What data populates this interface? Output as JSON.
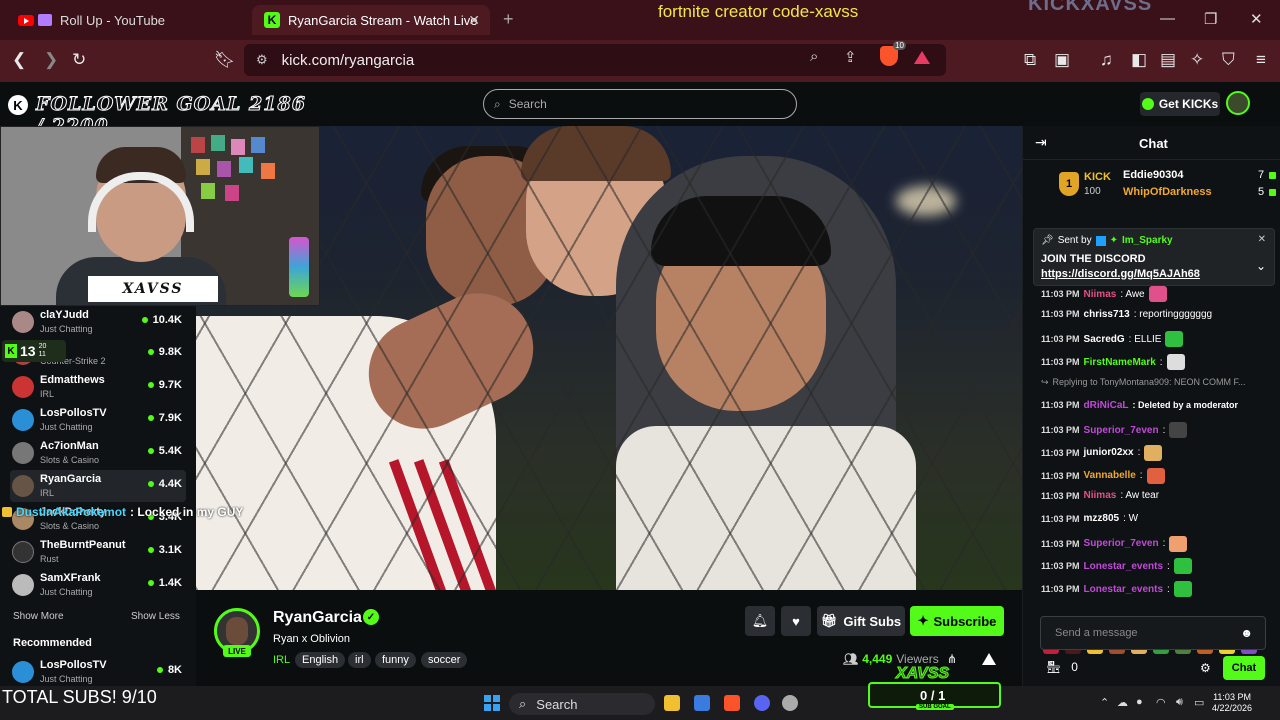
{
  "browser": {
    "tabs": [
      {
        "title": "Roll Up - YouTube",
        "active": false
      },
      {
        "title": "RyanGarcia Stream - Watch Live",
        "active": true
      }
    ],
    "url": "kick.com/ryangarcia",
    "brave_shield_count": "10"
  },
  "overlay": {
    "top_text": "fortnite creator code-xavss",
    "brand_text": "KICKXAVSS",
    "follower_goal": "FOLLOWER GOAL 2186 / 2200",
    "webcam_label": "XAVSS",
    "kick_badge_count": "13",
    "kick_badge_small1": "20",
    "kick_badge_small2": "11",
    "chat_overlay_user": "DustinAkaPokemot",
    "chat_overlay_text": ": Locked in my GUY",
    "total_subs": "TOTAL SUBS! 9/10",
    "sub_goal_value": "0 / 1",
    "sub_goal_label": "SUB GOAL",
    "sub_goal_logo": "XAVSS"
  },
  "kick": {
    "search_placeholder": "Search",
    "get_kicks": "Get KICKs",
    "sidebar": {
      "channels": [
        {
          "name": "claYJudd",
          "category": "Just Chatting",
          "viewers": "10.4K"
        },
        {
          "name": "",
          "category": "Counter-Strike 2",
          "viewers": "9.8K"
        },
        {
          "name": "Edmatthews",
          "category": "IRL",
          "viewers": "9.7K"
        },
        {
          "name": "LosPollosTV",
          "category": "Just Chatting",
          "viewers": "7.9K"
        },
        {
          "name": "Ac7ionMan",
          "category": "Slots & Casino",
          "viewers": "5.4K"
        },
        {
          "name": "RyanGarcia",
          "category": "IRL",
          "viewers": "4.4K"
        },
        {
          "name": "JackDoherty",
          "category": "Slots & Casino",
          "viewers": "3.4K"
        },
        {
          "name": "TheBurntPeanut",
          "category": "Rust",
          "viewers": "3.1K"
        },
        {
          "name": "SamXFrank",
          "category": "Just Chatting",
          "viewers": "1.4K"
        }
      ],
      "show_more": "Show More",
      "show_less": "Show Less",
      "recommended_title": "Recommended",
      "recommended": [
        {
          "name": "LosPollosTV",
          "category": "Just Chatting",
          "viewers": "8K"
        }
      ]
    },
    "stream": {
      "streamer": "RyanGarcia",
      "title": "Ryan x Oblivion",
      "category": "IRL",
      "tags": [
        "English",
        "irl",
        "funny",
        "soccer"
      ],
      "live_label": "LIVE",
      "gift_subs": "Gift Subs",
      "subscribe": "Subscribe",
      "viewers": "4,449",
      "viewers_label": "Viewers"
    },
    "chat": {
      "title": "Chat",
      "leaderboard": {
        "rank": "1",
        "kick_label": "KICK",
        "kick_count": "100",
        "entries": [
          {
            "name": "Eddie90304",
            "count": "7",
            "color": "#ffffff"
          },
          {
            "name": "WhipOfDarkness",
            "count": "5",
            "color": "#f0a830"
          }
        ]
      },
      "pinned": {
        "sent_by_label": "Sent by",
        "sent_by_user": "Im_Sparky",
        "line1": "JOIN THE DISCORD",
        "line2": "https://discord.gg/Mq5AJAh68"
      },
      "messages": [
        {
          "time": "11:03 PM",
          "user": "Niimas",
          "text": ": Awe",
          "color": "#e0508a"
        },
        {
          "time": "11:03 PM",
          "user": "chriss713",
          "text": ": reportinggggggg",
          "color": "#ffffff"
        },
        {
          "time": "11:03 PM",
          "user": "SacredG",
          "text": ": ELLIE",
          "color": "#ffffff"
        },
        {
          "time": "11:03 PM",
          "user": "FirstNameMark",
          "text": ":",
          "color": "#53fc18"
        },
        {
          "time": "",
          "user": "",
          "text": "Replying to TonyMontana909: NEON COMM F...",
          "color": "#999999"
        },
        {
          "time": "11:03 PM",
          "user": "dRiNiCaL",
          "text": ": Deleted by a moderator",
          "color": "#c04ad8"
        },
        {
          "time": "11:03 PM",
          "user": "Superior_7even",
          "text": ":",
          "color": "#c04ad8"
        },
        {
          "time": "11:03 PM",
          "user": "junior02xx",
          "text": ":",
          "color": "#ffffff"
        },
        {
          "time": "11:03 PM",
          "user": "Vannabelle",
          "text": ":",
          "color": "#f0a830"
        },
        {
          "time": "11:03 PM",
          "user": "Niimas",
          "text": ": Aw tear",
          "color": "#e0508a"
        },
        {
          "time": "11:03 PM",
          "user": "mzz805",
          "text": ": W",
          "color": "#ffffff"
        },
        {
          "time": "11:03 PM",
          "user": "Superior_7even",
          "text": ":",
          "color": "#c04ad8"
        },
        {
          "time": "11:03 PM",
          "user": "Lonestar_events",
          "text": ":",
          "color": "#c04ad8"
        },
        {
          "time": "11:03 PM",
          "user": "Lonestar_events",
          "text": ":",
          "color": "#c04ad8"
        }
      ],
      "input_placeholder": "Send a message",
      "kicks_balance": "0",
      "send_label": "Chat"
    }
  },
  "taskbar": {
    "search": "Search",
    "time": "11:03 PM",
    "date": "4/22/2026"
  },
  "colors": {
    "kick_green": "#53fc18",
    "browser_tab": "#3a1118",
    "browser_toolbar": "#4d1a22",
    "page_bg": "#0b0e0f"
  }
}
